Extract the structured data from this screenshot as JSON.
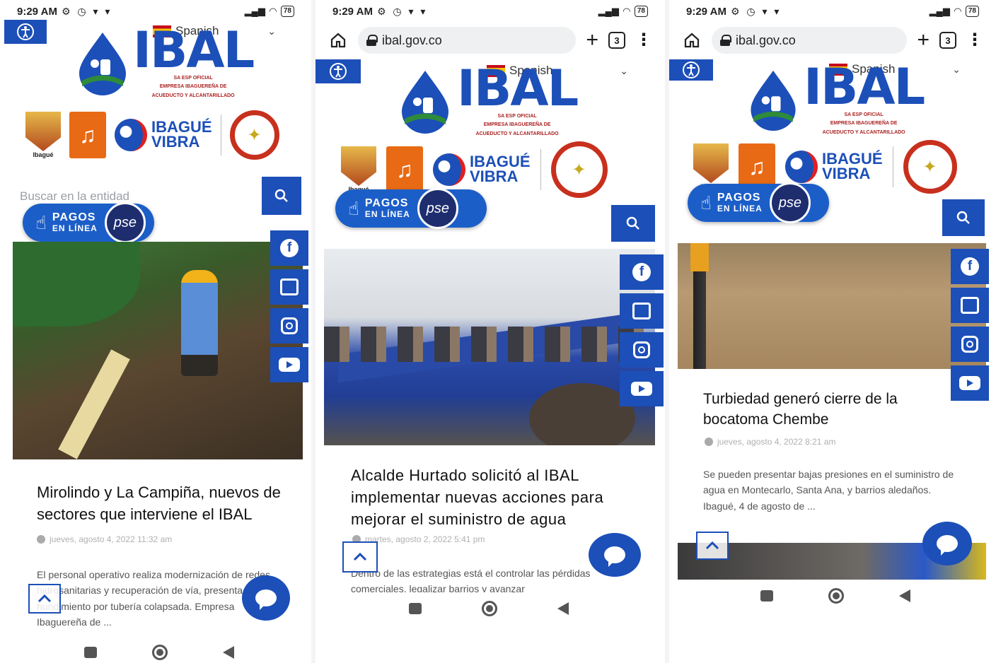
{
  "status": {
    "time": "9:29 AM",
    "battery": "78"
  },
  "browser": {
    "url": "ibal.gov.co",
    "tab_count": "3"
  },
  "site": {
    "brand": "IBAL",
    "brand_sub_1": "SA ESP OFICIAL",
    "brand_sub_2": "EMPRESA IBAGUEREÑA DE",
    "brand_sub_3": "ACUEDUCTO Y ALCANTARILLADO",
    "language": "Spanish",
    "search_placeholder": "Buscar en la entidad",
    "ibague_label": "Ibagué",
    "vibra_1": "IBAGUÉ",
    "vibra_2": "VIBRA",
    "pagos_1": "PAGOS",
    "pagos_2": "EN LÍNEA",
    "pse": "pse"
  },
  "articles": [
    {
      "title": "Mirolindo y La Campiña, nuevos de sectores que interviene el IBAL",
      "date": "jueves, agosto 4, 2022 11:32 am",
      "excerpt": "El personal operativo realiza modernización de redes hidrosanitarias y recuperación de vía, presenta hundimiento por tubería colapsada. Empresa Ibaguereña de ..."
    },
    {
      "title": "Alcalde Hurtado solicitó al IBAL implementar nuevas acciones para mejorar el suministro de agua",
      "date": "martes, agosto 2, 2022 5:41 pm",
      "excerpt": "Dentro de las estrategias está el controlar las pérdidas comerciales, legalizar barrios y avanzar"
    },
    {
      "title": "Turbiedad generó cierre de la bocatoma Chembe",
      "date": "jueves, agosto 4, 2022 8:21 am",
      "excerpt": "Se pueden presentar bajas presiones en el suministro de agua en Montecarlo, Santa Ana, y barrios aledaños. Ibagué, 4 de agosto de ..."
    }
  ],
  "colors": {
    "brand_blue": "#1c4fb8",
    "pagos_blue": "#1c5ec8",
    "seal_red": "#c8301e"
  }
}
